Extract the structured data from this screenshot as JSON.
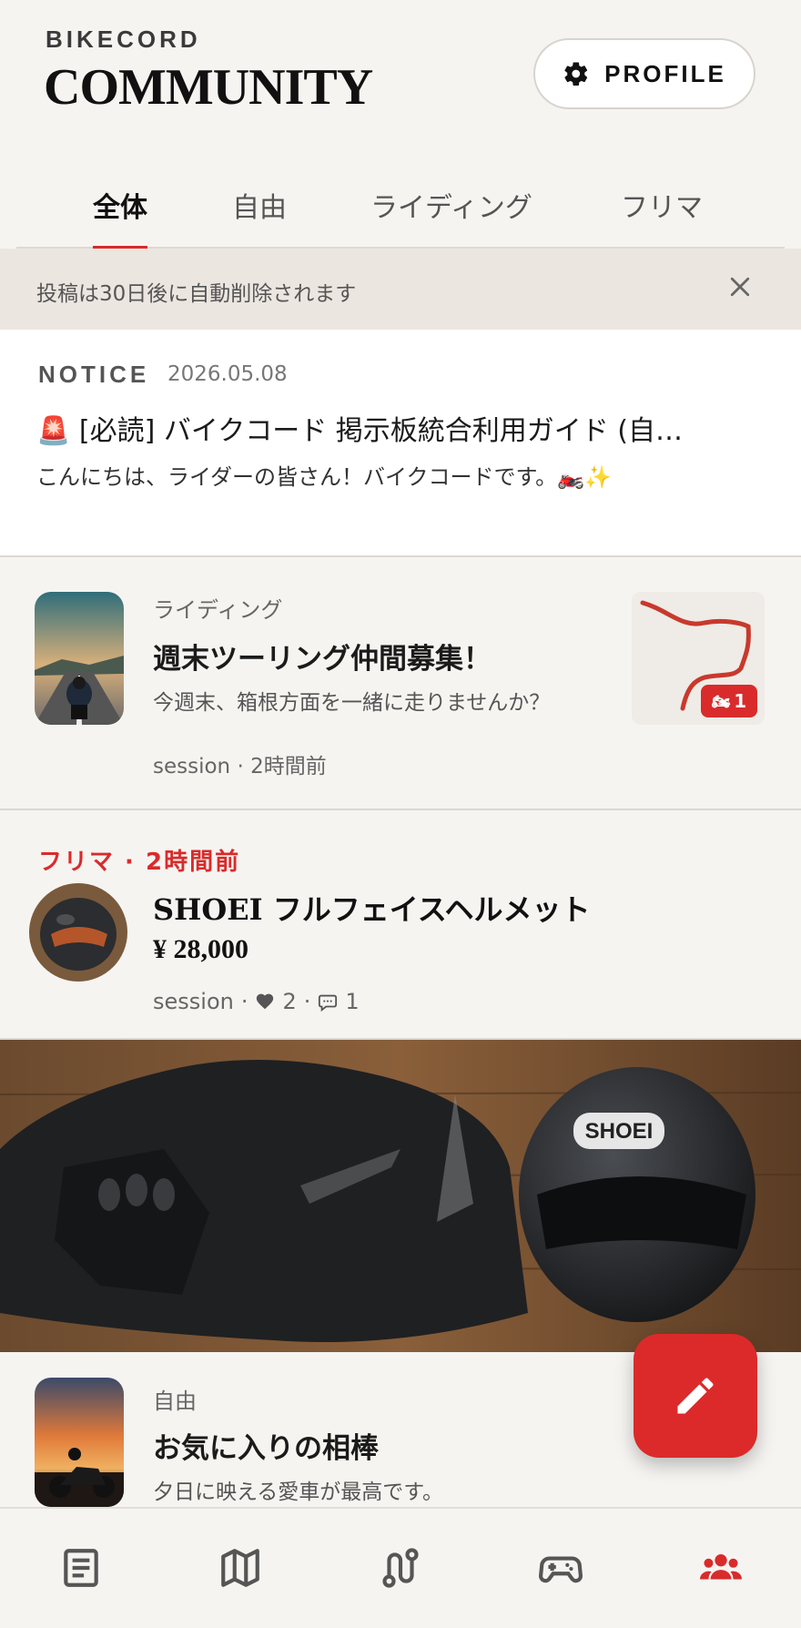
{
  "header": {
    "brand": "BIKECORD",
    "title": "COMMUNITY",
    "profile_label": "PROFILE"
  },
  "tabs": [
    {
      "label": "全体",
      "active": true
    },
    {
      "label": "自由",
      "active": false
    },
    {
      "label": "ライディング",
      "active": false
    },
    {
      "label": "フリマ",
      "active": false
    }
  ],
  "banner": {
    "text": "投稿は30日後に自動削除されます",
    "icon": "close-icon"
  },
  "notice": {
    "tag": "NOTICE",
    "date": "2026.05.08",
    "title": "🚨 [必読] バイクコード 掲示板統合利用ガイド (自…",
    "body": "こんにちは、ライダーの皆さん！バイクコードです。🏍️✨"
  },
  "posts": [
    {
      "category": "ライディング",
      "title": "週末ツーリング仲間募集！",
      "description": "今週末、箱根方面を一緒に走りませんか？",
      "meta": "session · 2時間前",
      "route_badge_count": "1"
    },
    {
      "header": "フリマ · 2時間前",
      "title": "SHOEI フルフェイスヘルメット",
      "price": "¥ 28,000",
      "author": "session",
      "sep": "·",
      "likes": "2",
      "comments": "1"
    },
    {
      "category": "自由",
      "title": "お気に入りの相棒",
      "description": "夕日に映える愛車が最高です。"
    }
  ],
  "colors": {
    "accent": "#d92b2b",
    "background": "#f6f4f1",
    "banner_bg": "#ece6e0"
  },
  "nav": [
    {
      "icon": "feed-icon",
      "active": false
    },
    {
      "icon": "map-icon",
      "active": false
    },
    {
      "icon": "route-icon",
      "active": false
    },
    {
      "icon": "gamepad-icon",
      "active": false
    },
    {
      "icon": "community-icon",
      "active": true
    }
  ]
}
